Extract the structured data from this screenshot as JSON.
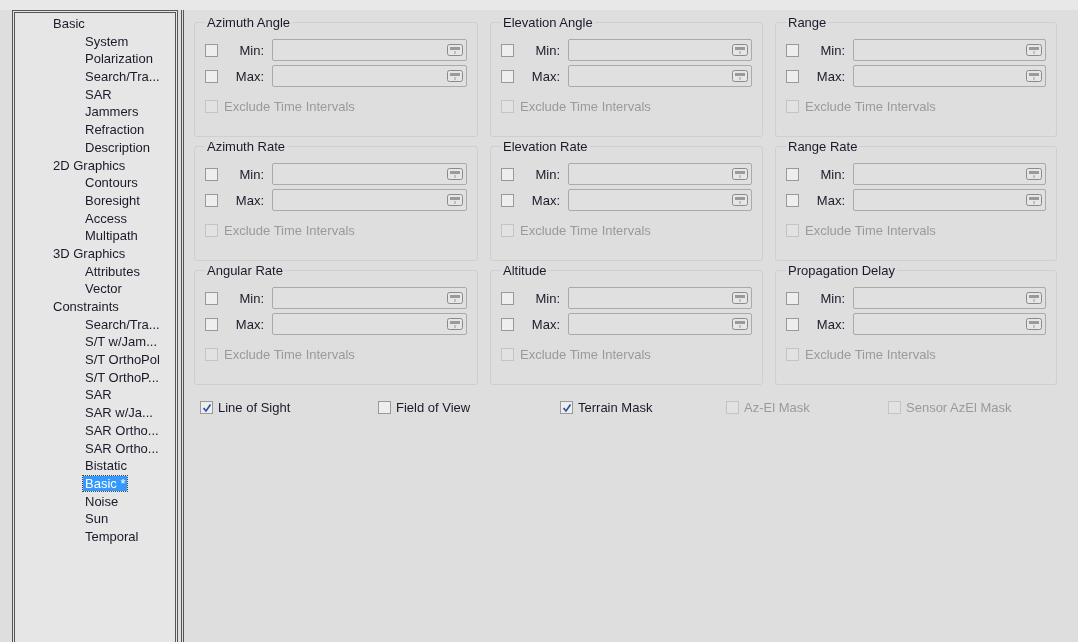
{
  "tree": [
    {
      "label": "Basic",
      "selected": false,
      "children": [
        {
          "label": "System",
          "selected": false
        },
        {
          "label": "Polarization",
          "selected": false
        },
        {
          "label": "Search/Tra...",
          "selected": false
        },
        {
          "label": "SAR",
          "selected": false
        },
        {
          "label": "Jammers",
          "selected": false
        },
        {
          "label": "Refraction",
          "selected": false
        },
        {
          "label": "Description",
          "selected": false
        }
      ]
    },
    {
      "label": "2D Graphics",
      "selected": false,
      "children": [
        {
          "label": "Contours",
          "selected": false
        },
        {
          "label": "Boresight",
          "selected": false
        },
        {
          "label": "Access",
          "selected": false
        },
        {
          "label": "Multipath",
          "selected": false
        }
      ]
    },
    {
      "label": "3D Graphics",
      "selected": false,
      "children": [
        {
          "label": "Attributes",
          "selected": false
        },
        {
          "label": "Vector",
          "selected": false
        }
      ]
    },
    {
      "label": "Constraints",
      "selected": false,
      "children": [
        {
          "label": "Search/Tra...",
          "selected": false
        },
        {
          "label": "S/T w/Jam...",
          "selected": false
        },
        {
          "label": "S/T OrthoPol",
          "selected": false
        },
        {
          "label": "S/T OrthoP...",
          "selected": false
        },
        {
          "label": "SAR",
          "selected": false
        },
        {
          "label": "SAR w/Ja...",
          "selected": false
        },
        {
          "label": "SAR Ortho...",
          "selected": false
        },
        {
          "label": "SAR Ortho...",
          "selected": false
        },
        {
          "label": "Bistatic",
          "selected": false
        },
        {
          "label": "Basic *",
          "selected": true
        },
        {
          "label": "Noise",
          "selected": false
        },
        {
          "label": "Sun",
          "selected": false
        },
        {
          "label": "Temporal",
          "selected": false
        }
      ]
    }
  ],
  "groups": [
    {
      "title": "Azimuth Angle",
      "min": {
        "label": "Min:",
        "checked": false
      },
      "max": {
        "label": "Max:",
        "checked": false
      },
      "exclude": {
        "label": "Exclude Time Intervals",
        "checked": false
      }
    },
    {
      "title": "Elevation Angle",
      "min": {
        "label": "Min:",
        "checked": false
      },
      "max": {
        "label": "Max:",
        "checked": false
      },
      "exclude": {
        "label": "Exclude Time Intervals",
        "checked": false
      }
    },
    {
      "title": "Range",
      "min": {
        "label": "Min:",
        "checked": false
      },
      "max": {
        "label": "Max:",
        "checked": false
      },
      "exclude": {
        "label": "Exclude Time Intervals",
        "checked": false
      }
    },
    {
      "title": "Azimuth Rate",
      "min": {
        "label": "Min:",
        "checked": false
      },
      "max": {
        "label": "Max:",
        "checked": false
      },
      "exclude": {
        "label": "Exclude Time Intervals",
        "checked": false
      }
    },
    {
      "title": "Elevation Rate",
      "min": {
        "label": "Min:",
        "checked": false
      },
      "max": {
        "label": "Max:",
        "checked": false
      },
      "exclude": {
        "label": "Exclude Time Intervals",
        "checked": false
      }
    },
    {
      "title": "Range Rate",
      "min": {
        "label": "Min:",
        "checked": false
      },
      "max": {
        "label": "Max:",
        "checked": false
      },
      "exclude": {
        "label": "Exclude Time Intervals",
        "checked": false
      }
    },
    {
      "title": "Angular Rate",
      "min": {
        "label": "Min:",
        "checked": false
      },
      "max": {
        "label": "Max:",
        "checked": false
      },
      "exclude": {
        "label": "Exclude Time Intervals",
        "checked": false
      }
    },
    {
      "title": "Altitude",
      "min": {
        "label": "Min:",
        "checked": false
      },
      "max": {
        "label": "Max:",
        "checked": false
      },
      "exclude": {
        "label": "Exclude Time Intervals",
        "checked": false
      }
    },
    {
      "title": "Propagation Delay",
      "min": {
        "label": "Min:",
        "checked": false
      },
      "max": {
        "label": "Max:",
        "checked": false
      },
      "exclude": {
        "label": "Exclude Time Intervals",
        "checked": false
      }
    }
  ],
  "options": [
    {
      "label": "Line of Sight",
      "checked": true,
      "disabled": false
    },
    {
      "label": "Field of View",
      "checked": false,
      "disabled": false
    },
    {
      "label": "Terrain Mask",
      "checked": true,
      "disabled": false
    },
    {
      "label": "Az-El Mask",
      "checked": false,
      "disabled": true
    },
    {
      "label": "Sensor AzEl Mask",
      "checked": false,
      "disabled": true
    }
  ]
}
